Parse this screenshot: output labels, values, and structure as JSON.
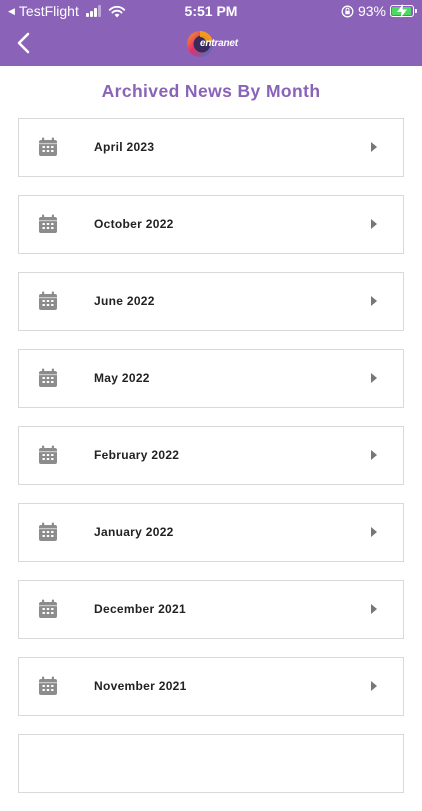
{
  "status_bar": {
    "back_app": "TestFlight",
    "time": "5:51 PM",
    "battery": "93%"
  },
  "header": {
    "logo_text": "entranet"
  },
  "page": {
    "title": "Archived News By Month"
  },
  "months": [
    {
      "label": "April 2023"
    },
    {
      "label": "October 2022"
    },
    {
      "label": "June 2022"
    },
    {
      "label": "May 2022"
    },
    {
      "label": "February 2022"
    },
    {
      "label": "January 2022"
    },
    {
      "label": "December 2021"
    },
    {
      "label": "November 2021"
    },
    {
      "label": ""
    }
  ],
  "colors": {
    "header_bg": "#8a62b8",
    "title": "#8a62b8",
    "icon": "#8c8c8c",
    "battery_fill": "#4cd964"
  }
}
